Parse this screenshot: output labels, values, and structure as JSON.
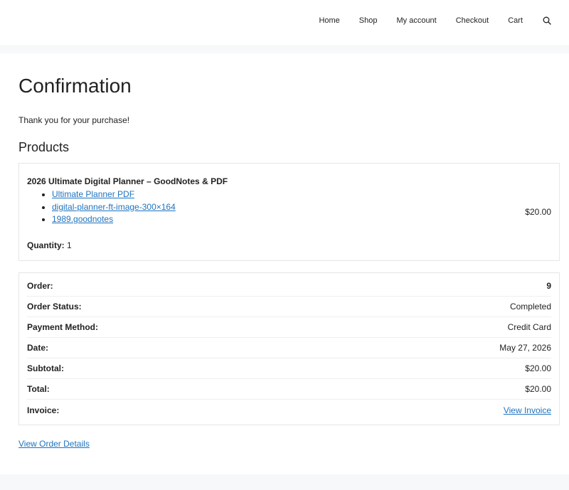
{
  "nav": {
    "items": [
      "Home",
      "Shop",
      "My account",
      "Checkout",
      "Cart"
    ],
    "search_icon": "search-icon"
  },
  "page": {
    "title": "Confirmation",
    "thanks": "Thank you for your purchase!",
    "products_heading": "Products"
  },
  "product": {
    "name": "2026 Ultimate Digital Planner – GoodNotes & PDF",
    "downloads": [
      "Ultimate Planner PDF",
      "digital-planner-ft-image-300×164",
      "1989.goodnotes"
    ],
    "quantity_label": "Quantity:",
    "quantity": "1",
    "price": "$20.00"
  },
  "order": {
    "rows": [
      {
        "label": "Order:",
        "value": "9"
      },
      {
        "label": "Order Status:",
        "value": "Completed"
      },
      {
        "label": "Payment Method:",
        "value": "Credit Card"
      },
      {
        "label": "Date:",
        "value": "May 27, 2026"
      },
      {
        "label": "Subtotal:",
        "value": "$20.00"
      },
      {
        "label": "Total:",
        "value": "$20.00"
      },
      {
        "label": "Invoice:",
        "value": "View Invoice"
      }
    ]
  },
  "view_order_details": "View Order Details",
  "colors": {
    "link": "#1e73be",
    "page_bg": "#f7f8f9",
    "text": "#222222"
  }
}
